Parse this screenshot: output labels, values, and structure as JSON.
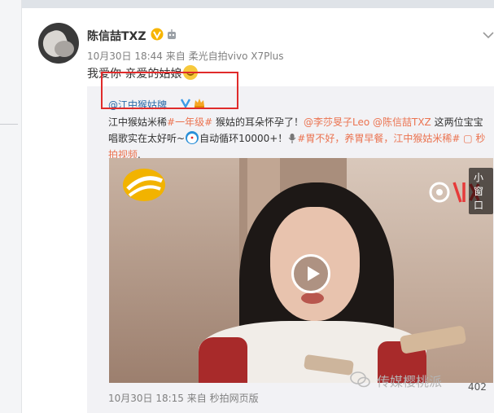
{
  "author": {
    "name": "陈信喆TXZ",
    "meta": "10月30日 18:44 来自 柔光自拍vivo X7Plus"
  },
  "post": {
    "text": "我爱你 亲爱的姑娘"
  },
  "repost": {
    "user": "@江中猴姑牌",
    "text_parts": {
      "p1": "江中猴姑米稀",
      "p2": "#一年级#",
      "p3": " 猴姑的耳朵怀孕了！",
      "p4": "@李莎旻子Leo",
      "p5": " ",
      "p6": "@陈信喆TXZ",
      "p7": " 这两位宝宝唱歌实在太好听~",
      "p8": "自动循环10000+！",
      "p9": "#胃不好，养胃早餐，江中猴姑米稀#",
      "p10": "秒拍视频",
      "p11": "."
    },
    "meta": "10月30日 18:15 来自 秒拍网页版",
    "video": {
      "small_window_label": "小窗口"
    }
  },
  "watermark": {
    "text": "传媒樱桃派",
    "number": "402"
  },
  "colors": {
    "link": "#eb7350",
    "user_link": "#2a6aa8",
    "highlight_box": "#e02b2b"
  }
}
